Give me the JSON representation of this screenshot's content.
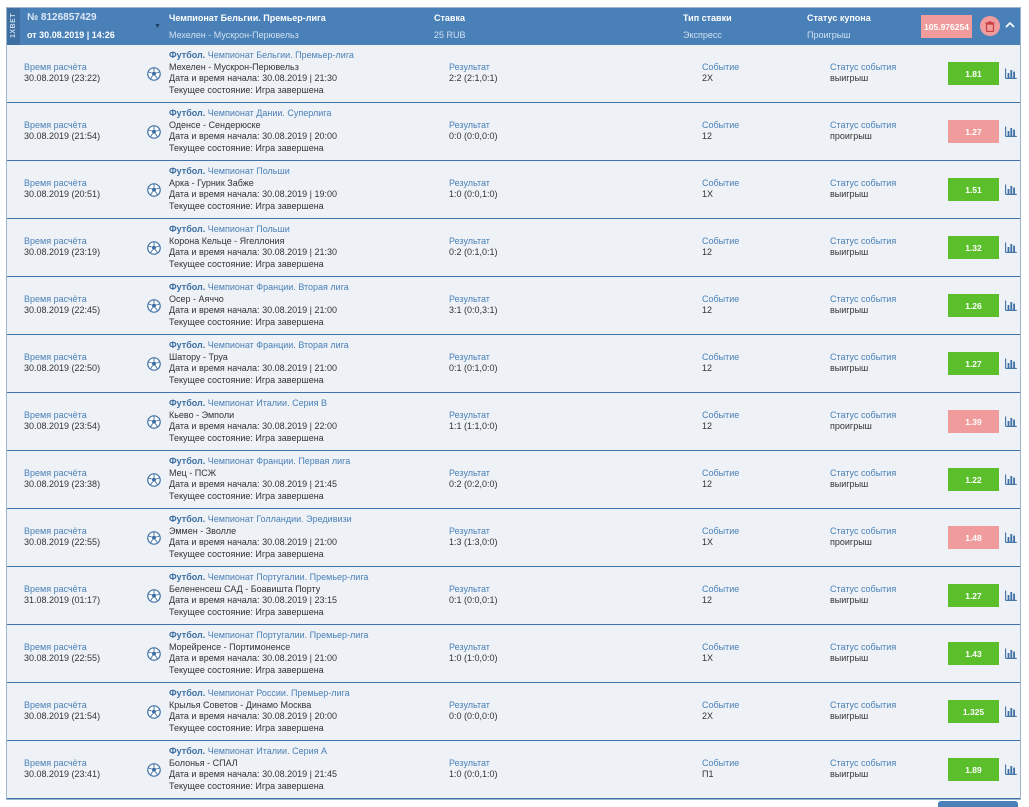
{
  "header": {
    "brand": "1XBET",
    "coupon_number": "№ 8126857429",
    "coupon_date": "от 30.08.2019 | 14:26",
    "league_label": "Чемпионат Бельгии. Премьер-лига",
    "match": "Мехелен - Мускрон-Перювельз",
    "stake_label": "Ставка",
    "stake_value": "25 RUB",
    "bet_type_label": "Тип ставки",
    "bet_type_value": "Экспресс",
    "status_label": "Статус купона",
    "status_value": "Проигрыш",
    "amount": "105.976254"
  },
  "labels": {
    "calc_time": "Время расчёта",
    "result": "Результат",
    "event": "Событие",
    "event_status": "Статус события",
    "sport": "Футбол.",
    "start_prefix": "Дата и время начала:",
    "state_prefix": "Текущее состояние:"
  },
  "colors": {
    "header_blue": "#4a80b8",
    "win_green": "#5bbf2c",
    "lose_pink": "#f19c9c",
    "row_bg": "#eef2f6"
  },
  "rows": [
    {
      "calc_time": "30.08.2019 (23:22)",
      "league": "Чемпионат Бельгии. Премьер-лига",
      "teams": "Мехелен - Мускрон-Перювельз",
      "start": "30.08.2019 | 21:30",
      "state": "Игра завершена",
      "result": "2:2 (2:1,0:1)",
      "event": "2X",
      "status": "выигрыш",
      "odds": "1.81",
      "won": true
    },
    {
      "calc_time": "30.08.2019 (21:54)",
      "league": "Чемпионат Дании. Суперлига",
      "teams": "Оденсе - Сендерюске",
      "start": "30.08.2019 | 20:00",
      "state": "Игра завершена",
      "result": "0:0 (0:0,0:0)",
      "event": "12",
      "status": "проигрыш",
      "odds": "1.27",
      "won": false
    },
    {
      "calc_time": "30.08.2019 (20:51)",
      "league": "Чемпионат Польши",
      "teams": "Арка - Гурник Забже",
      "start": "30.08.2019 | 19:00",
      "state": "Игра завершена",
      "result": "1:0 (0:0,1:0)",
      "event": "1X",
      "status": "выигрыш",
      "odds": "1.51",
      "won": true
    },
    {
      "calc_time": "30.08.2019 (23:19)",
      "league": "Чемпионат Польши",
      "teams": "Корона Кельце - Ягеллония",
      "start": "30.08.2019 | 21:30",
      "state": "Игра завершена",
      "result": "0:2 (0:1,0:1)",
      "event": "12",
      "status": "выигрыш",
      "odds": "1.32",
      "won": true
    },
    {
      "calc_time": "30.08.2019 (22:45)",
      "league": "Чемпионат Франции. Вторая лига",
      "teams": "Осер - Аяччо",
      "start": "30.08.2019 | 21:00",
      "state": "Игра завершена",
      "result": "3:1 (0:0,3:1)",
      "event": "12",
      "status": "выигрыш",
      "odds": "1.26",
      "won": true
    },
    {
      "calc_time": "30.08.2019 (22:50)",
      "league": "Чемпионат Франции. Вторая лига",
      "teams": "Шатору - Труа",
      "start": "30.08.2019 | 21:00",
      "state": "Игра завершена",
      "result": "0:1 (0:1,0:0)",
      "event": "12",
      "status": "выигрыш",
      "odds": "1.27",
      "won": true
    },
    {
      "calc_time": "30.08.2019 (23:54)",
      "league": "Чемпионат Италии. Серия B",
      "teams": "Кьево - Эмполи",
      "start": "30.08.2019 | 22:00",
      "state": "Игра завершена",
      "result": "1:1 (1:1,0:0)",
      "event": "12",
      "status": "проигрыш",
      "odds": "1.39",
      "won": false
    },
    {
      "calc_time": "30.08.2019 (23:38)",
      "league": "Чемпионат Франции. Первая лига",
      "teams": "Мец - ПСЖ",
      "start": "30.08.2019 | 21:45",
      "state": "Игра завершена",
      "result": "0:2 (0:2,0:0)",
      "event": "12",
      "status": "выигрыш",
      "odds": "1.22",
      "won": true
    },
    {
      "calc_time": "30.08.2019 (22:55)",
      "league": "Чемпионат Голландии. Эредивизи",
      "teams": "Эммен - Зволле",
      "start": "30.08.2019 | 21:00",
      "state": "Игра завершена",
      "result": "1:3 (1:3,0:0)",
      "event": "1X",
      "status": "проигрыш",
      "odds": "1.48",
      "won": false
    },
    {
      "calc_time": "31.08.2019 (01:17)",
      "league": "Чемпионат Португалии. Премьер-лига",
      "teams": "Белененсеш САД - Боавишта Порту",
      "start": "30.08.2019 | 23:15",
      "state": "Игра завершена",
      "result": "0:1 (0:0,0:1)",
      "event": "12",
      "status": "выигрыш",
      "odds": "1.27",
      "won": true
    },
    {
      "calc_time": "30.08.2019 (22:55)",
      "league": "Чемпионат Португалии. Премьер-лига",
      "teams": "Морейренсе - Портимоненсе",
      "start": "30.08.2019 | 21:00",
      "state": "Игра завершена",
      "result": "1:0 (1:0,0:0)",
      "event": "1X",
      "status": "выигрыш",
      "odds": "1.43",
      "won": true
    },
    {
      "calc_time": "30.08.2019 (21:54)",
      "league": "Чемпионат России. Премьер-лига",
      "teams": "Крылья Советов - Динамо Москва",
      "start": "30.08.2019 | 20:00",
      "state": "Игра завершена",
      "result": "0:0 (0:0,0:0)",
      "event": "2X",
      "status": "выигрыш",
      "odds": "1.325",
      "won": true
    },
    {
      "calc_time": "30.08.2019 (23:41)",
      "league": "Чемпионат Италии. Серия А",
      "teams": "Болонья - СПАЛ",
      "start": "30.08.2019 | 21:45",
      "state": "Игра завершена",
      "result": "1:0 (0:0,1:0)",
      "event": "П1",
      "status": "выигрыш",
      "odds": "1.89",
      "won": true
    }
  ]
}
